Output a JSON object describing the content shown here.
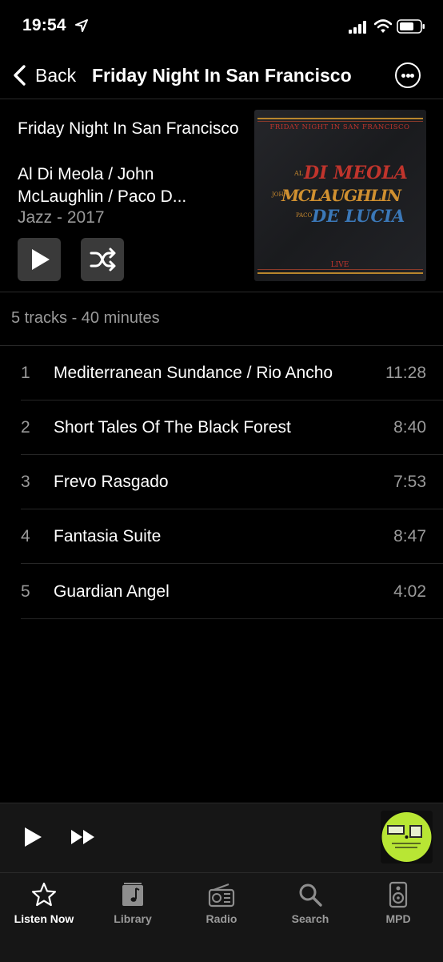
{
  "status_bar": {
    "time": "19:54"
  },
  "nav": {
    "back_label": "Back",
    "title": "Friday Night In San Francisco"
  },
  "album": {
    "title": "Friday Night In San Francisco",
    "artist": "Al Di Meola / John McLaughlin / Paco D...",
    "meta": "Jazz - 2017",
    "cover_text": {
      "banner": "FRIDAY NIGHT IN SAN FRANCISCO",
      "artist1": "DI MEOLA",
      "artist1_prefix": "AL",
      "artist2": "MCLAUGHLIN",
      "artist2_prefix": "JOHN",
      "artist3": "DE LUCIA",
      "artist3_prefix": "PACO",
      "footer": "LIVE"
    }
  },
  "summary": "5 tracks - 40 minutes",
  "tracks": [
    {
      "num": "1",
      "title": "Mediterranean Sundance / Rio Ancho",
      "duration": "11:28"
    },
    {
      "num": "2",
      "title": "Short Tales Of The Black Forest",
      "duration": "8:40"
    },
    {
      "num": "3",
      "title": "Frevo Rasgado",
      "duration": "7:53"
    },
    {
      "num": "4",
      "title": "Fantasia Suite",
      "duration": "8:47"
    },
    {
      "num": "5",
      "title": "Guardian Angel",
      "duration": "4:02"
    }
  ],
  "tabs": [
    {
      "label": "Listen Now",
      "icon": "star-icon",
      "active": true
    },
    {
      "label": "Library",
      "icon": "music-note-icon",
      "active": false
    },
    {
      "label": "Radio",
      "icon": "radio-icon",
      "active": false
    },
    {
      "label": "Search",
      "icon": "search-icon",
      "active": false
    },
    {
      "label": "MPD",
      "icon": "speaker-icon",
      "active": false
    }
  ],
  "colors": {
    "background": "#000000",
    "secondary_text": "#9a9a9a",
    "button_bg": "#3a3a3a",
    "bar_bg": "#161616"
  }
}
